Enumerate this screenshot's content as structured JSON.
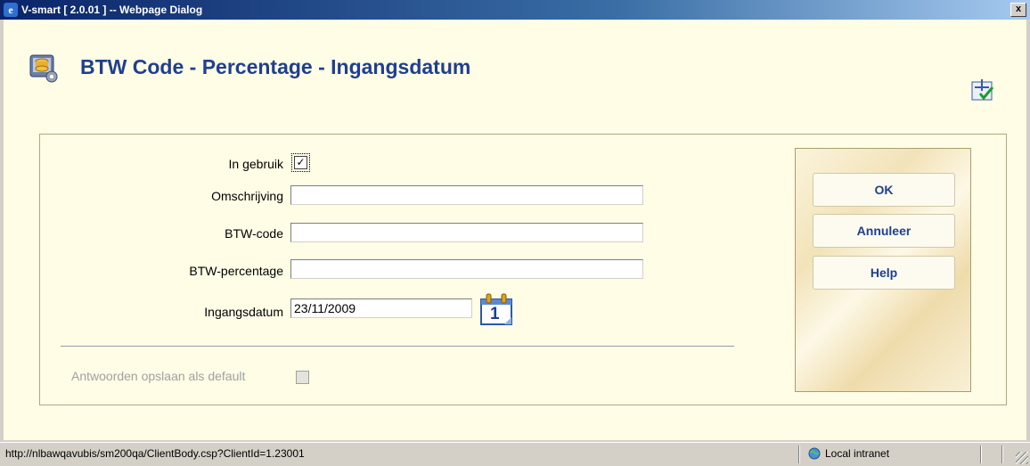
{
  "window": {
    "title": "V-smart [ 2.0.01 ] -- Webpage Dialog",
    "close_label": "x"
  },
  "page": {
    "title": "BTW Code - Percentage - Ingangsdatum"
  },
  "form": {
    "in_gebruik": {
      "label": "In gebruik",
      "checked": true
    },
    "omschrijving": {
      "label": "Omschrijving",
      "value": ""
    },
    "btw_code": {
      "label": "BTW-code",
      "value": ""
    },
    "btw_percentage": {
      "label": "BTW-percentage",
      "value": ""
    },
    "ingangsdatum": {
      "label": "Ingangsdatum",
      "value": "23/11/2009"
    },
    "calendar_day": "1",
    "save_default": {
      "label": "Antwoorden opslaan als default",
      "checked": false,
      "disabled": true
    }
  },
  "buttons": {
    "ok": "OK",
    "cancel": "Annuleer",
    "help": "Help"
  },
  "statusbar": {
    "url": "http://nlbawqavubis/sm200qa/ClientBody.csp?ClientId=1.23001",
    "zone": "Local intranet"
  },
  "colors": {
    "title_blue": "#1f3f8f",
    "background": "#fffde6"
  }
}
